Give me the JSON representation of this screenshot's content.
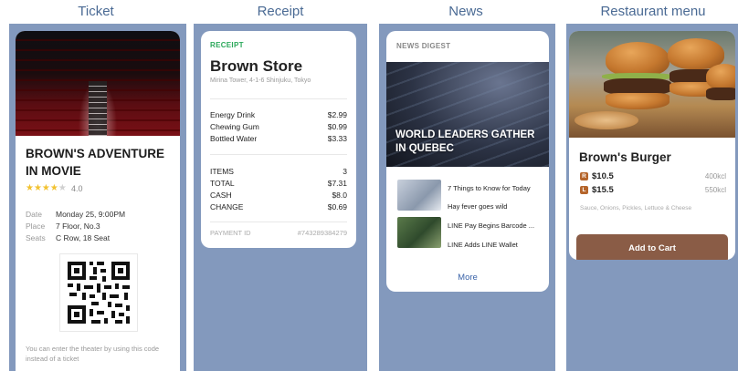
{
  "columns": {
    "ticket": "Ticket",
    "receipt": "Receipt",
    "news": "News",
    "menu": "Restaurant menu"
  },
  "ticket": {
    "title": "BROWN'S ADVENTURE IN MOVIE",
    "stars": "★★★★",
    "stars_empty": "★",
    "rating": "4.0",
    "rows": [
      {
        "label": "Date",
        "value": "Monday 25, 9:00PM"
      },
      {
        "label": "Place",
        "value": "7 Floor, No.3"
      },
      {
        "label": "Seats",
        "value": "C Row, 18 Seat"
      }
    ],
    "note": "You can enter the theater by using this code instead of a ticket"
  },
  "receipt": {
    "label": "RECEIPT",
    "store": "Brown Store",
    "address": "Mirina Tower, 4-1-6 Shinjuku, Tokyo",
    "items": [
      {
        "name": "Energy Drink",
        "price": "$2.99"
      },
      {
        "name": "Chewing Gum",
        "price": "$0.99"
      },
      {
        "name": "Bottled Water",
        "price": "$3.33"
      }
    ],
    "summary": [
      {
        "name": "ITEMS",
        "value": "3"
      },
      {
        "name": "TOTAL",
        "value": "$7.31"
      },
      {
        "name": "CASH",
        "value": "$8.0"
      },
      {
        "name": "CHANGE",
        "value": "$0.69"
      }
    ],
    "payment_label": "PAYMENT ID",
    "payment_id": "#743289384279"
  },
  "news": {
    "label": "NEWS DIGEST",
    "headline": "WORLD LEADERS GATHER IN QUEBEC",
    "items": [
      "7 Things to Know for Today",
      "Hay fever goes wild",
      "LINE Pay Begins Barcode ...",
      "LINE Adds LINE Wallet"
    ],
    "more": "More"
  },
  "menu": {
    "title": "Brown's Burger",
    "prices": [
      {
        "badge": "R",
        "price": "$10.5",
        "kcal": "400kcl"
      },
      {
        "badge": "L",
        "price": "$15.5",
        "kcal": "550kcl"
      }
    ],
    "description": "Sauce, Onions, Pickles, Lettuce & Cheese",
    "cart_button": "Add to Cart"
  }
}
